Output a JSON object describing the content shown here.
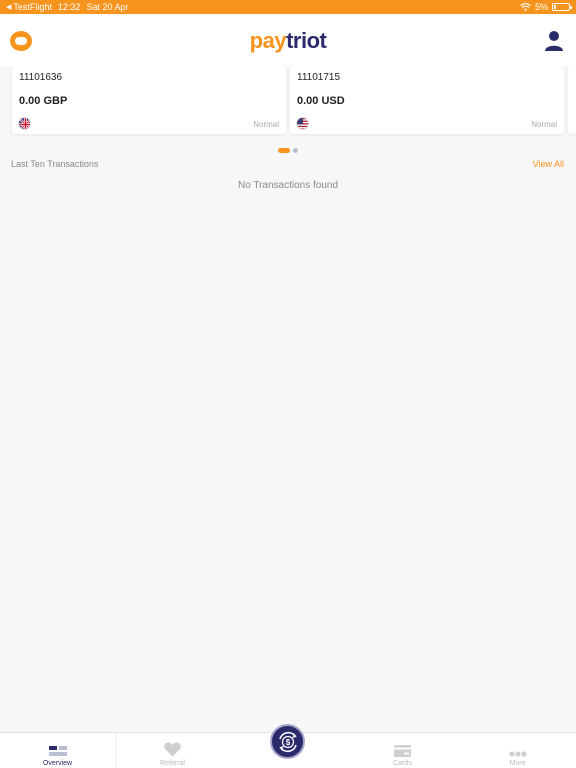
{
  "status_bar": {
    "back_app": "TestFlight",
    "time": "12:32",
    "date": "Sat 20 Apr",
    "battery": "5%"
  },
  "header": {
    "logo_part1": "pay",
    "logo_part2": "triot"
  },
  "accounts": [
    {
      "number": "11101636",
      "balance": "0.00 GBP",
      "status": "Normal",
      "flag": "uk-flag-icon"
    },
    {
      "number": "11101715",
      "balance": "0.00 USD",
      "status": "Normal",
      "flag": "us-flag-icon"
    }
  ],
  "transactions": {
    "title": "Last Ten Transactions",
    "view_all": "View All",
    "empty_message": "No Transactions found"
  },
  "tabbar": {
    "items": [
      {
        "label": "Overview",
        "icon": "overview-icon",
        "active": true
      },
      {
        "label": "Referral",
        "icon": "heart-icon",
        "active": false
      },
      {
        "label": "Cards",
        "icon": "card-icon",
        "active": false
      },
      {
        "label": "More",
        "icon": "more-dots-icon",
        "active": false
      }
    ],
    "center_icon": "exchange-dollar-icon"
  },
  "colors": {
    "accent": "#f7941d",
    "brand_dark": "#2b2a6b",
    "background": "#f7f7f7"
  }
}
